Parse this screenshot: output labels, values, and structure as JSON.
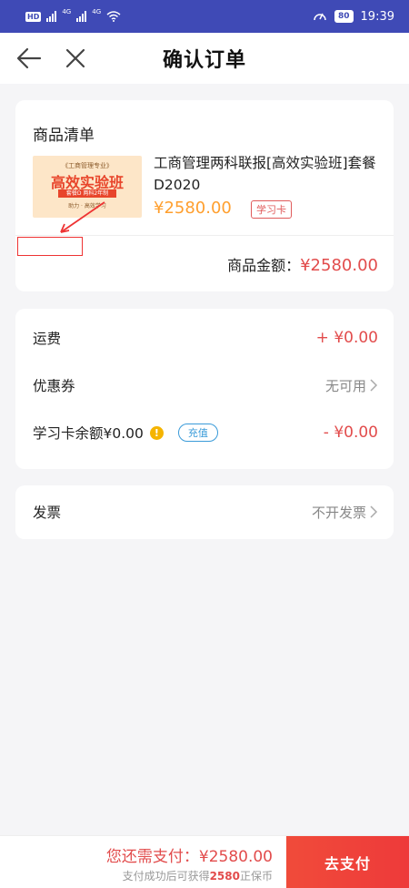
{
  "status": {
    "hd": "HD",
    "sig1": "4G",
    "sig2": "4G",
    "battery": "80",
    "time": "19:39"
  },
  "nav": {
    "title": "确认订单",
    "back_icon": "arrow-left-icon",
    "close_icon": "close-icon"
  },
  "goods": {
    "section_title": "商品清单",
    "thumb": {
      "top_text": "《工商管理专业》",
      "main_text": "高效实验班",
      "ribbon_text": "套餐D 两科2年制",
      "foot_text": "助力 · 高效学习"
    },
    "name": "工商管理两科联报[高效实验班]套餐D2020",
    "price": "¥2580.00",
    "tag": "学习卡",
    "total_label": "商品金额：",
    "total_value": "¥2580.00"
  },
  "fees": {
    "shipping_label": "运费",
    "shipping_value": "+ ¥0.00",
    "coupon_label": "优惠券",
    "coupon_value": "无可用",
    "card_balance_label": "学习卡余额¥0.00",
    "recharge_label": "充值",
    "card_balance_value": "- ¥0.00"
  },
  "invoice": {
    "label": "发票",
    "value": "不开发票"
  },
  "footer": {
    "amount_text": "您还需支付：¥2580.00",
    "note_prefix": "支付成功后可获得",
    "note_coins": "2580",
    "note_suffix": "正保币",
    "pay_button": "去支付"
  },
  "colors": {
    "accent": "#ee3a3a",
    "price": "#ff9f2e",
    "status_bar": "#3f4ab6",
    "link": "#3a9bd9"
  }
}
